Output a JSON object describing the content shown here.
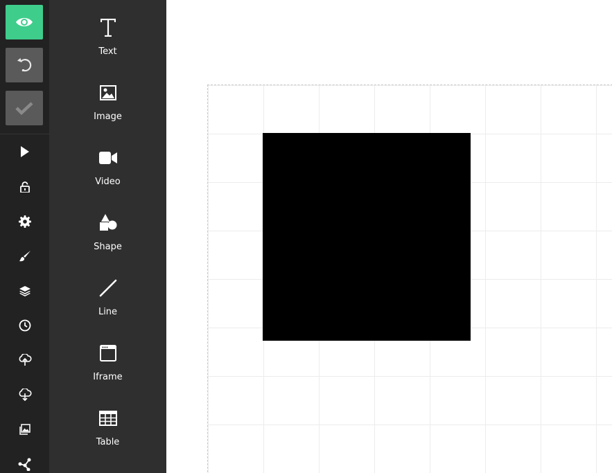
{
  "toolbar": {
    "primary": [
      {
        "name": "preview-button",
        "icon": "eye-icon"
      },
      {
        "name": "undo-button",
        "icon": "undo-icon"
      },
      {
        "name": "save-button",
        "icon": "check-icon"
      }
    ],
    "tools": [
      "play-icon",
      "lock-icon",
      "gear-icon",
      "brush-icon",
      "layers-icon",
      "clock-icon",
      "cloud-upload-icon",
      "cloud-download-icon",
      "image-icon",
      "share-icon"
    ],
    "colors": {
      "preview": "#3fcd8c",
      "inactive": "#5a5a5a",
      "background": "#222222"
    }
  },
  "panel": {
    "items": [
      {
        "label": "Text",
        "icon": "text-icon"
      },
      {
        "label": "Image",
        "icon": "image-icon"
      },
      {
        "label": "Video",
        "icon": "video-icon"
      },
      {
        "label": "Shape",
        "icon": "shape-icon"
      },
      {
        "label": "Line",
        "icon": "line-icon"
      },
      {
        "label": "Iframe",
        "icon": "iframe-icon"
      },
      {
        "label": "Table",
        "icon": "table-icon"
      }
    ]
  },
  "canvas": {
    "shape_color": "#000000"
  }
}
